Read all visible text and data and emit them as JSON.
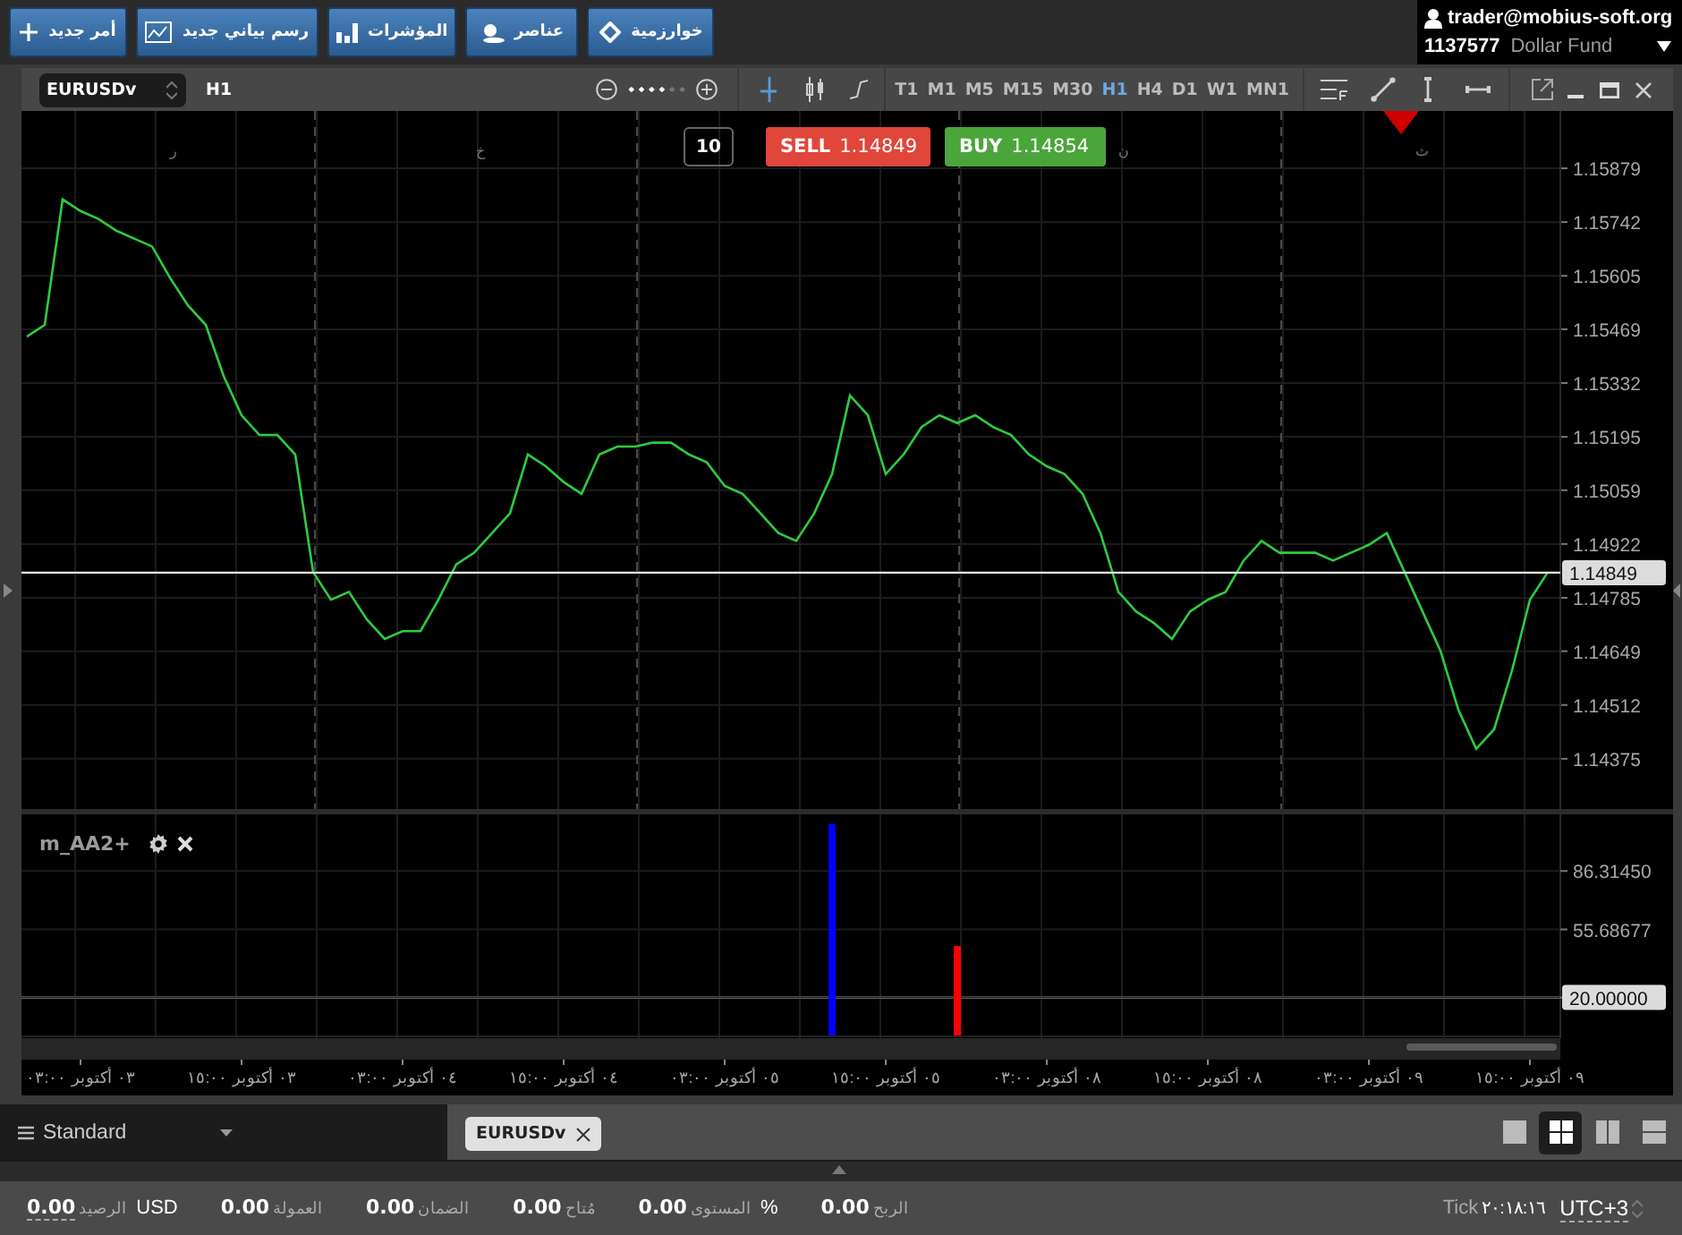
{
  "toolbar_buttons": [
    {
      "label": "خوارزمية"
    },
    {
      "label": "عناصر"
    },
    {
      "label": "المؤشرات"
    },
    {
      "label": "رسم بياني جديد"
    },
    {
      "label": "أمر جديد"
    }
  ],
  "account": {
    "user": "trader@mobius-soft.org",
    "number": "1137577",
    "name": "Dollar Fund"
  },
  "chart_window": {
    "symbol": "EURUSDv",
    "period": "H1",
    "zoom": {
      "level": 0.67
    },
    "timeframes": [
      {
        "label": "MN1",
        "selected": false
      },
      {
        "label": "W1",
        "selected": false
      },
      {
        "label": "D1",
        "selected": false
      },
      {
        "label": "H4",
        "selected": false
      },
      {
        "label": "H1",
        "selected": true
      },
      {
        "label": "M30",
        "selected": false
      },
      {
        "label": "M15",
        "selected": false
      },
      {
        "label": "M5",
        "selected": false
      },
      {
        "label": "M1",
        "selected": false
      },
      {
        "label": "T1",
        "selected": false
      }
    ],
    "trade": {
      "volume": "10",
      "sell": {
        "label": "SELL",
        "price": "1.14849"
      },
      "buy": {
        "label": "BUY",
        "price": "1.14854"
      }
    },
    "day_markers": [
      "ث",
      "ن",
      "خ",
      "ر"
    ],
    "price_chart": {
      "chart_data": {
        "type": "line",
        "categories": [
          null,
          null,
          null,
          null,
          null,
          null,
          null,
          null,
          null,
          null,
          null,
          null,
          null,
          null,
          null,
          null,
          null,
          null,
          null,
          null,
          null,
          null,
          null,
          null,
          null,
          null,
          null,
          null,
          null,
          null,
          null,
          null,
          null,
          null,
          null,
          null,
          null,
          null,
          null,
          null,
          null,
          null,
          null,
          null,
          null,
          null,
          null,
          null,
          null,
          null,
          null,
          null,
          null,
          null,
          null,
          null,
          null,
          null,
          null,
          null,
          null,
          null,
          null,
          null,
          null,
          null,
          null,
          null,
          null,
          null,
          null,
          null,
          null,
          null,
          null,
          null,
          null,
          null,
          null,
          null,
          null,
          null,
          null,
          null,
          null,
          null
        ],
        "series": [
          {
            "color": "#2ecc40",
            "values": [
              1.1545,
              1.1548,
              1.158,
              1.1577,
              1.1575,
              1.1572,
              1.157,
              1.1568,
              1.156,
              1.1553,
              1.1548,
              1.1535,
              1.1525,
              1.152,
              1.152,
              1.1515,
              1.1485,
              1.1478,
              1.148,
              1.1473,
              1.1468,
              1.147,
              1.147,
              1.1478,
              1.1487,
              1.149,
              1.1495,
              1.15,
              1.1515,
              1.1512,
              1.1508,
              1.1505,
              1.1515,
              1.1517,
              1.1517,
              1.1518,
              1.1518,
              1.1515,
              1.1513,
              1.1507,
              1.1505,
              1.15,
              1.1495,
              1.1493,
              1.15,
              1.151,
              1.153,
              1.1525,
              1.151,
              1.1515,
              1.1522,
              1.1525,
              1.1523,
              1.1525,
              1.1522,
              1.152,
              1.1515,
              1.1512,
              1.151,
              1.1505,
              1.1495,
              1.148,
              1.1475,
              1.1472,
              1.1468,
              1.1475,
              1.1478,
              1.148,
              1.1488,
              1.1493,
              1.149,
              1.149,
              1.149,
              1.1488,
              1.149,
              1.1492,
              1.1495,
              1.1485,
              1.1475,
              1.1465,
              1.145,
              1.144,
              1.1445,
              1.146,
              1.1478,
              1.1485
            ]
          }
        ],
        "ylim": [
          1.14247,
          1.16025
        ],
        "yticks": [
          1.15879,
          1.15742,
          1.15605,
          1.15469,
          1.15332,
          1.15195,
          1.15059,
          1.14922,
          1.14785,
          1.14649,
          1.14512,
          1.14375
        ],
        "grid": true,
        "ref_lines": [
          {
            "axis": "y",
            "value": 1.14849,
            "label": "1.14849"
          }
        ]
      }
    },
    "indicator": {
      "name": "m_AA2+",
      "chart_data": {
        "type": "bar",
        "categories": [
          null,
          null,
          null,
          "٠٣ أكتوبر ٠٣:٠٠",
          null,
          null,
          null,
          null,
          null,
          null,
          null,
          null,
          "٠٣ أكتوبر ١٥:٠٠",
          null,
          null,
          null,
          null,
          null,
          null,
          null,
          null,
          "٠٤ أكتوبر ٠٣:٠٠",
          null,
          null,
          null,
          null,
          null,
          null,
          null,
          null,
          "٠٤ أكتوبر ١٥:٠٠",
          null,
          null,
          null,
          null,
          null,
          null,
          null,
          null,
          "٠٥ أكتوبر ٠٣:٠٠",
          null,
          null,
          null,
          null,
          null,
          null,
          null,
          null,
          "٠٥ أكتوبر ١٥:٠٠",
          null,
          null,
          null,
          null,
          null,
          null,
          null,
          null,
          "٠٨ أكتوبر ٠٣:٠٠",
          null,
          null,
          null,
          null,
          null,
          null,
          null,
          null,
          "٠٨ أكتوبر ١٥:٠٠",
          null,
          null,
          null,
          null,
          null,
          null,
          null,
          null,
          "٠٩ أكتوبر ٠٣:٠٠",
          null,
          null,
          null,
          null,
          null,
          null,
          null,
          null,
          "٠٩ أكتوبر ١٥:٠٠",
          null
        ],
        "series": [
          {
            "color": "#0000ff",
            "values": [
              null,
              null,
              null,
              null,
              null,
              null,
              null,
              null,
              null,
              null,
              null,
              null,
              null,
              null,
              null,
              null,
              null,
              null,
              null,
              null,
              null,
              null,
              null,
              null,
              null,
              null,
              null,
              null,
              null,
              null,
              null,
              null,
              null,
              null,
              null,
              null,
              null,
              null,
              null,
              null,
              null,
              null,
              null,
              null,
              null,
              111,
              null,
              null,
              null,
              null,
              null,
              null,
              null,
              null,
              null,
              null,
              null,
              null,
              null,
              null,
              null,
              null,
              null,
              null,
              null,
              null,
              null,
              null,
              null,
              null,
              null,
              null,
              null,
              null,
              null,
              null,
              null,
              null,
              null,
              null,
              null,
              null,
              null,
              null,
              null,
              null
            ]
          },
          {
            "color": "#ff0000",
            "values": [
              null,
              null,
              null,
              null,
              null,
              null,
              null,
              null,
              null,
              null,
              null,
              null,
              null,
              null,
              null,
              null,
              null,
              null,
              null,
              null,
              null,
              null,
              null,
              null,
              null,
              null,
              null,
              null,
              null,
              null,
              null,
              null,
              null,
              null,
              null,
              null,
              null,
              null,
              null,
              null,
              null,
              null,
              null,
              null,
              null,
              null,
              null,
              null,
              null,
              null,
              null,
              null,
              47,
              null,
              null,
              null,
              null,
              null,
              null,
              null,
              null,
              null,
              null,
              null,
              null,
              null,
              null,
              null,
              null,
              null,
              null,
              null,
              null,
              null,
              null,
              null,
              null,
              null,
              null,
              null,
              null,
              null,
              null,
              null,
              null,
              null
            ]
          }
        ],
        "ylim": [
          -1.3,
          116
        ],
        "yticks": [
          {
            "value": 86.3145,
            "label": "86.31450"
          },
          {
            "value": 55.68677,
            "label": "55.68677"
          },
          {
            "value": 20,
            "label": "20.00000"
          }
        ],
        "grid": true,
        "ref_lines": [
          {
            "axis": "y",
            "value": 20
          }
        ]
      }
    }
  },
  "workspace": {
    "name": "Standard"
  },
  "tabs": [
    {
      "label": "EURUSDv",
      "selected": true
    }
  ],
  "layouts": [
    {
      "selected": false
    },
    {
      "selected": true
    },
    {
      "selected": false
    },
    {
      "selected": false
    }
  ],
  "status_bar": {
    "stats": [
      {
        "value": "0.00",
        "label": "الربح"
      },
      {
        "value": "0.00",
        "label": "المستوى",
        "unit": "%"
      },
      {
        "value": "0.00",
        "label": "مُتاح"
      },
      {
        "value": "0.00",
        "label": "الضمان"
      },
      {
        "value": "0.00",
        "label": "العمولة"
      },
      {
        "value": "0.00",
        "label": "الرصيد",
        "unit": "USD"
      }
    ],
    "clock_label": "Tick",
    "time": "٢٠:١٨:١٦",
    "timezone": "UTC+3"
  }
}
